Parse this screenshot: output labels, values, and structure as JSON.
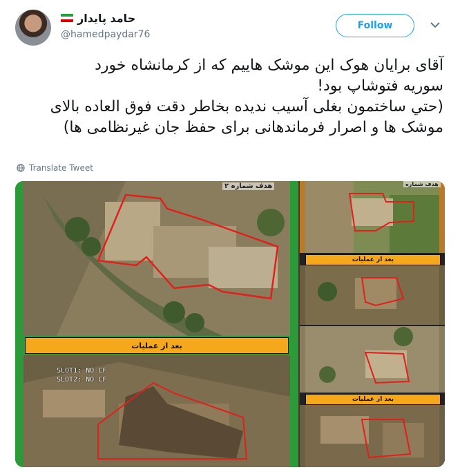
{
  "user": {
    "display_name": "حامد پایدار",
    "handle": "@hamedpaydar76"
  },
  "actions": {
    "follow_label": "Follow",
    "translate_label": "Translate Tweet"
  },
  "tweet": {
    "lines": [
      "آقای برایان هوک این موشک هاییم که از کرمانشاه خورد",
      "سوریه فتوشاپ بود!",
      "(حتي ساختمون بغلی آسیب ندیده بخاطر دقت فوق العاده بالای",
      "موشک ها و اصرار فرماندهانی برای حفظ جان غیرنظامی ها)"
    ]
  },
  "media": {
    "left_top_caption": "هدف شماره ۲",
    "left_label": "بعد از عملیات",
    "osd_line1": "SLOT1: NO CF",
    "osd_line2": "SLOT2: NO CF",
    "right_top_caption": "هدف شماره",
    "right_label_1": "بعد از عملیات",
    "right_label_2": "بعد از عملیات"
  },
  "colors": {
    "accent": "#1da1f2",
    "label_bar": "#f5a81c",
    "target_outline": "#e0201b"
  }
}
